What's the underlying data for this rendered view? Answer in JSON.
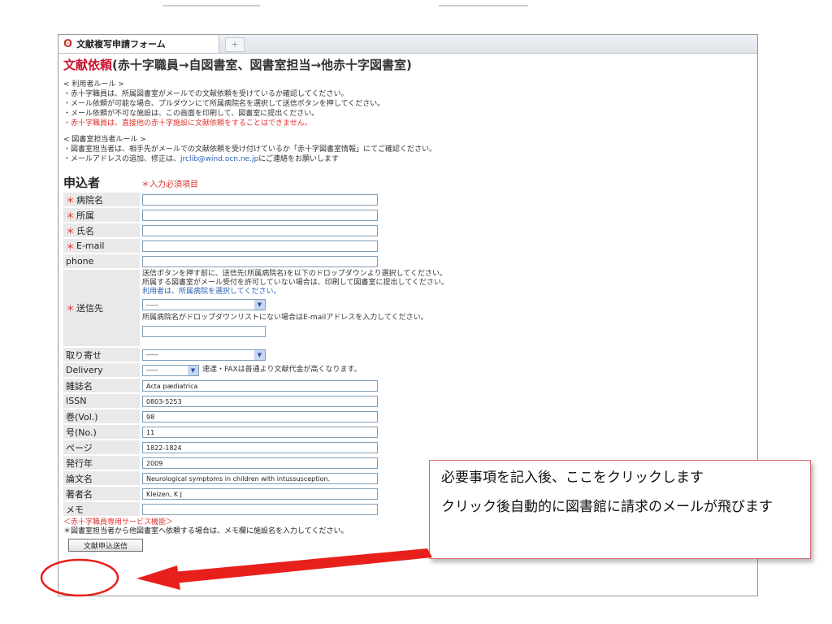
{
  "tab": {
    "title": "文献複写申請フォーム",
    "new_tab": "+"
  },
  "page": {
    "title_red": "文献依頼",
    "title_rest": "(赤十字職員→自図書室、図書室担当→他赤十字図書室)"
  },
  "user_rules": {
    "heading": "< 利用者ルール >",
    "lines": [
      "・赤十字職員は、所属図書室がメールでの文献依頼を受けているか確認してください。",
      "・メール依頼が可能な場合、プルダウンにて所属病院名を選択して送信ボタンを押してください。",
      "・メール依頼が不可な施設は、この画面を印刷して、図書室に提出ください。"
    ],
    "warning": "・赤十字職員は、直接他の赤十字施設に文献依頼をすることはできません。"
  },
  "staff_rules": {
    "heading": "< 図書室担当者ルール >",
    "line1": "・図書室担当者は、相手先がメールでの文献依頼を受け付けているか「赤十字図書室情報」にてご確認ください。",
    "line2_pre": "・メールアドレスの追加、修正は、",
    "email": "jrclib@wind.ocn.ne.jp",
    "line2_post": "にご連絡をお願いします"
  },
  "form": {
    "section_title": "申込者",
    "required_note": "＊入力必須項目",
    "required_mark": "＊",
    "fields": {
      "hospital": "病院名",
      "department": "所属",
      "name": "氏名",
      "email": "E-mail",
      "phone": "phone"
    },
    "destination": {
      "label": "送信先",
      "note1": "送信ボタンを押す前に、送信先(所属病院名)を以下のドロップダウンより選択してください。",
      "note2": "所属する図書室がメール受付を許可していない場合は、印刷して図書室に提出してください。",
      "note3": "利用者は、所属病院を選択してください。",
      "select_value": "-----",
      "email_note": "所属病院名がドロップダウンリストにない場合はE-mailアドレスを入力してください。"
    },
    "retrieval": {
      "label": "取り寄せ",
      "value": "-----"
    },
    "delivery": {
      "label": "Delivery",
      "value": "-----",
      "note": "速達・FAXは普通より文献代金が高くなります。"
    },
    "journal": {
      "label": "雑誌名",
      "value": "Acta pædiatrica"
    },
    "issn": {
      "label": "ISSN",
      "value": "0803-5253"
    },
    "volume": {
      "label": "巻(Vol.)",
      "value": "98"
    },
    "number": {
      "label": "号(No.)",
      "value": "11"
    },
    "pages": {
      "label": "ページ",
      "value": "1822-1824"
    },
    "year": {
      "label": "発行年",
      "value": "2009"
    },
    "article": {
      "label": "論文名",
      "value": "Neurological symptoms in children with intussusception."
    },
    "author": {
      "label": "著者名",
      "value": "Kleizen, K J"
    },
    "memo": {
      "label": "メモ",
      "value": ""
    },
    "service_note": "＜赤十字職員専用サービス機能＞",
    "staff_note": "＊図書室担当者から他図書室へ依頼する場合は、メモ欄に施設名を入力してください。",
    "submit_label": "文献申込送信"
  },
  "callout": {
    "line1": "必要事項を記入後、ここをクリックします",
    "line2": "クリック後自動的に図書館に請求のメールが飛びます"
  },
  "colors": {
    "accent_red": "#e0312e",
    "arrow_red": "#e8201c",
    "label_bg": "#e9e9e9",
    "link_blue": "#2b5fb4"
  }
}
